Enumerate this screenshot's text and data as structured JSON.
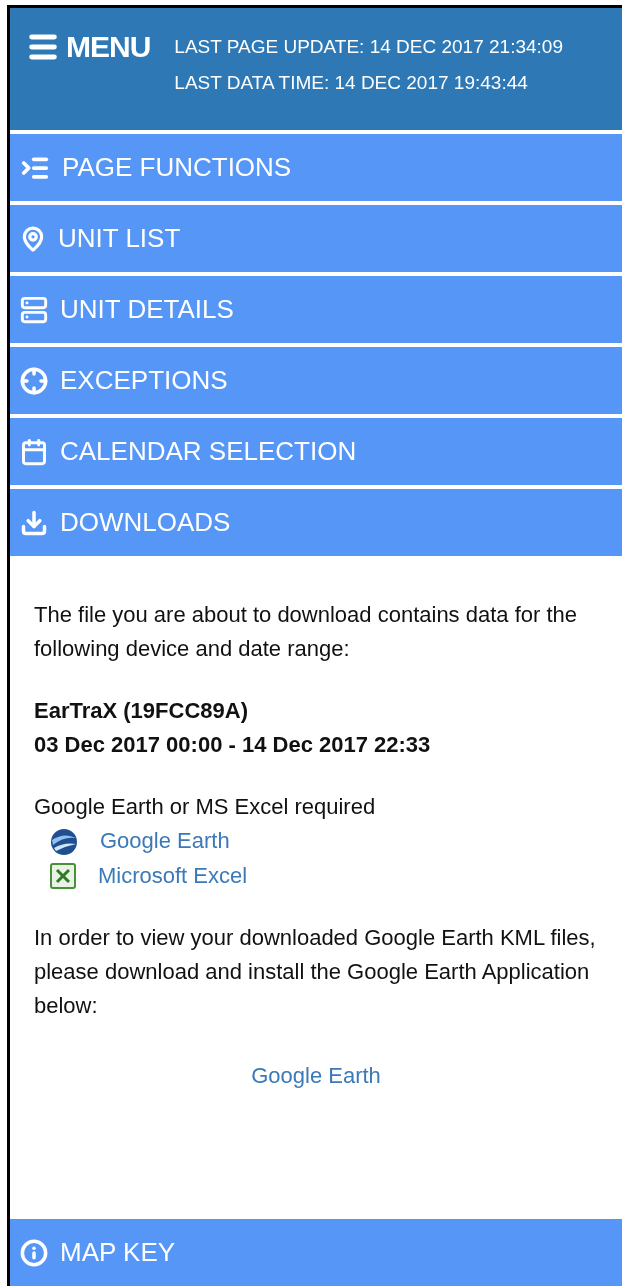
{
  "header": {
    "menu_label": "MENU",
    "last_page_update": "LAST PAGE UPDATE: 14 DEC 2017 21:34:09",
    "last_data_time": "LAST DATA TIME: 14 DEC 2017 19:43:44"
  },
  "sections": [
    {
      "kind": "indent",
      "label": "PAGE FUNCTIONS",
      "expanded": false
    },
    {
      "kind": "pin",
      "label": "UNIT LIST",
      "expanded": false
    },
    {
      "kind": "rows",
      "label": "UNIT DETAILS",
      "expanded": false
    },
    {
      "kind": "target",
      "label": "EXCEPTIONS",
      "expanded": false
    },
    {
      "kind": "calendar",
      "label": "CALENDAR SELECTION",
      "expanded": false
    },
    {
      "kind": "download",
      "label": "DOWNLOADS",
      "expanded": true
    },
    {
      "kind": "info",
      "label": "MAP KEY",
      "expanded": false
    }
  ],
  "downloads_panel": {
    "intro": "The file you are about to download contains data for the following device and date range:",
    "device": "EarTraX (19FCC89A)",
    "date_range": "03 Dec 2017 00:00 - 14 Dec 2017 22:33",
    "requirement": "Google Earth or MS Excel required",
    "links": [
      {
        "kind": "globe",
        "label": "Google Earth"
      },
      {
        "kind": "sheet",
        "label": "Microsoft Excel"
      }
    ],
    "install_note": "In order to view your downloaded Google Earth KML files, please download and install the Google Earth Application below:",
    "install_link": "Google Earth"
  }
}
